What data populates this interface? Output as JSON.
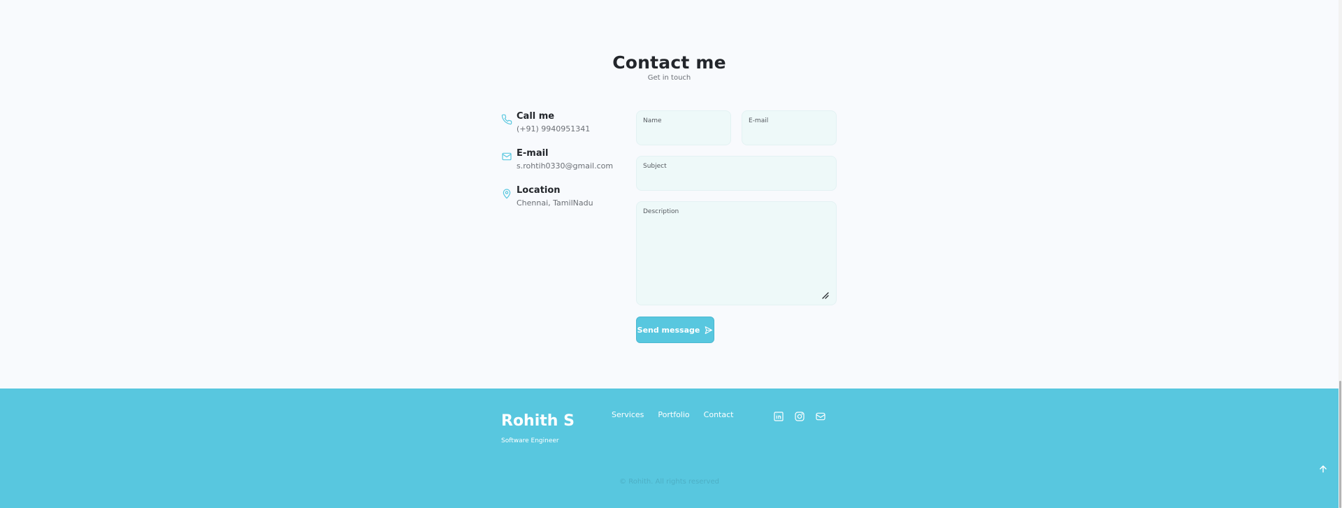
{
  "contact": {
    "title": "Contact me",
    "subtitle": "Get in touch",
    "info": [
      {
        "icon": "phone-icon",
        "title": "Call me",
        "value": "(+91) 9940951341"
      },
      {
        "icon": "mail-icon",
        "title": "E-mail",
        "value": "s.rohtih0330@gmail.com"
      },
      {
        "icon": "map-pin-icon",
        "title": "Location",
        "value": "Chennai, TamilNadu"
      }
    ],
    "form": {
      "name_label": "Name",
      "email_label": "E-mail",
      "subject_label": "Subject",
      "description_label": "Description",
      "send_label": "Send message"
    }
  },
  "footer": {
    "brand": "Rohith S",
    "role": "Software Engineer",
    "links": [
      "Services",
      "Portfolio",
      "Contact"
    ],
    "social": [
      "linkedin-icon",
      "instagram-icon",
      "mail-icon"
    ],
    "copyright": "© Rohith. All rights reserved"
  },
  "colors": {
    "accent": "#58c7df",
    "background": "#f8fafd",
    "field_bg": "#eef9f9",
    "title": "#23262b"
  }
}
